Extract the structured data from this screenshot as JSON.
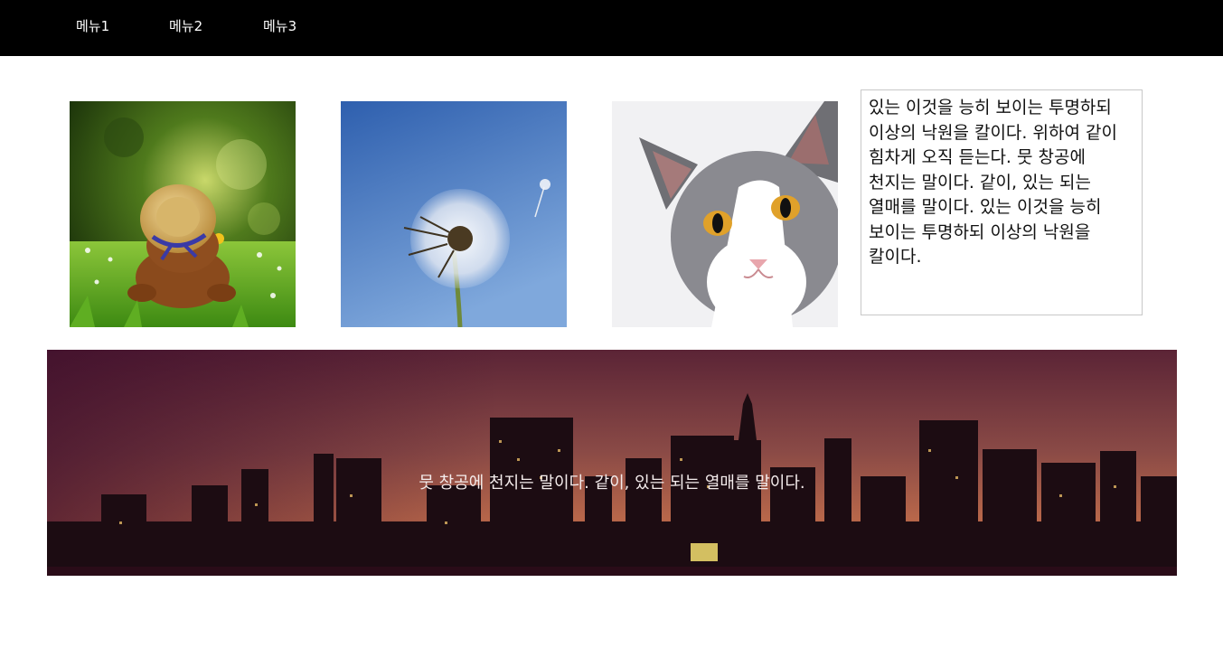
{
  "nav": {
    "items": [
      {
        "label": "메뉴1"
      },
      {
        "label": "메뉴2"
      },
      {
        "label": "메뉴3"
      }
    ]
  },
  "gallery": {
    "images": [
      {
        "subject": "teddy-bear-with-straw-hat-on-grass"
      },
      {
        "subject": "dandelion-against-blue-sky"
      },
      {
        "subject": "gray-white-cat-face"
      }
    ]
  },
  "textbox": {
    "content": "있는 이것을 능히 보이는 투명하되 이상의 낙원을 칼이다. 위하여 같이 힘차게 오직 듣는다. 뭇 창공에 천지는 말이다. 같이, 있는 되는 열매를 말이다. 있는 이것을 능히 보이는 투명하되 이상의 낙원을 칼이다."
  },
  "banner": {
    "text": "뭇 창공에 천지는 말이다. 같이, 있는 되는 열매를 말이다.",
    "subject": "city-skyline-at-dusk"
  },
  "colors": {
    "topbar": "#000000",
    "nav_text": "#ffffff",
    "textbox_border": "#c8c8c8"
  }
}
